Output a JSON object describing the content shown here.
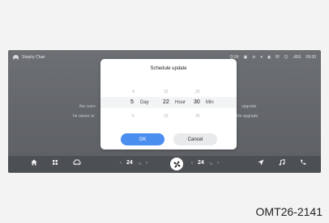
{
  "status_bar": {
    "user_name": "Stephy Chair",
    "indicators": [
      "Q:24",
      "▣",
      "⊖",
      "▾",
      "◉",
      "B!",
      "Q",
      ".ıl5G",
      "09:30"
    ]
  },
  "background": {
    "left_line_1": "the curre",
    "left_line_2": "he owner re",
    "right_line_1": "upgrade",
    "right_line_2": "tile upgrade"
  },
  "dialog": {
    "title": "Schedule update",
    "above": [
      "4",
      "22",
      "25"
    ],
    "selected": {
      "day": "5",
      "day_unit": "Day",
      "hour": "22",
      "hour_unit": "Hour",
      "minute": "30",
      "minute_unit": "Min"
    },
    "below": [
      "6",
      "23",
      "35"
    ],
    "ok_label": "OK",
    "cancel_label": "Cancel"
  },
  "dock": {
    "left_temp_label": "24",
    "left_temp_unit": "°C",
    "right_temp_label": "24",
    "right_temp_unit": "°C",
    "icons": [
      "home-icon",
      "apps-icon",
      "car-icon",
      "fan-icon",
      "navigation-icon",
      "music-icon",
      "phone-icon"
    ]
  },
  "reference_code": "OMT26-2141",
  "colors": {
    "accent": "#4a8ef0",
    "screen": "#666a6e",
    "dock": "#4c4f53"
  }
}
